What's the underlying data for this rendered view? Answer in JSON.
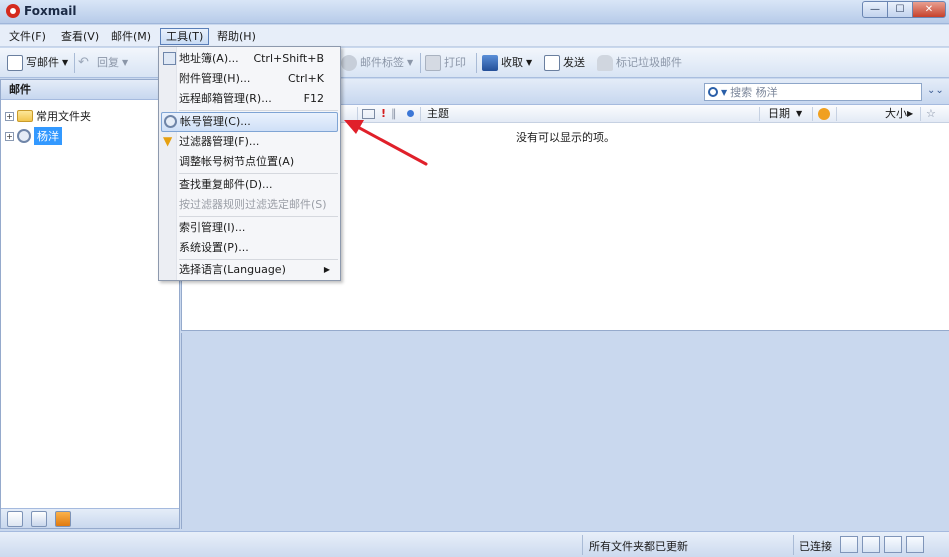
{
  "window": {
    "title": "Foxmail"
  },
  "menubar": {
    "items": [
      "文件(F)",
      "查看(V)",
      "邮件(M)",
      "工具(T)",
      "帮助(H)"
    ]
  },
  "toolbar": {
    "compose": "写邮件",
    "reply": "回复",
    "tag": "邮件标签",
    "print": "打印",
    "receive": "收取",
    "send": "发送",
    "junk": "标记垃圾邮件"
  },
  "folder_pane": {
    "header": "邮件",
    "tree": [
      {
        "label": "常用文件夹",
        "selected": false
      },
      {
        "label": "杨洋",
        "selected": true
      }
    ]
  },
  "search": {
    "placeholder": "搜索 杨洋"
  },
  "list": {
    "columns": {
      "subject": "主题",
      "date": "日期",
      "size": "大小"
    },
    "empty_message": "没有可以显示的项。"
  },
  "statusbar": {
    "message": "所有文件夹都已更新",
    "connection": "已连接"
  },
  "tools_menu": {
    "items": [
      {
        "label": "地址簿(A)...",
        "shortcut": "Ctrl+Shift+B",
        "disabled": false
      },
      {
        "label": "附件管理(H)...",
        "shortcut": "Ctrl+K",
        "disabled": false
      },
      {
        "label": "远程邮箱管理(R)...",
        "shortcut": "F12",
        "disabled": false
      },
      {
        "label": "帐号管理(C)...",
        "shortcut": "",
        "disabled": false,
        "highlight": true
      },
      {
        "label": "过滤器管理(F)...",
        "shortcut": "",
        "disabled": false
      },
      {
        "label": "调整帐号树节点位置(A)",
        "shortcut": "",
        "disabled": false
      },
      {
        "label": "查找重复邮件(D)...",
        "shortcut": "",
        "disabled": false
      },
      {
        "label": "按过滤器规则过滤选定邮件(S)",
        "shortcut": "",
        "disabled": true
      },
      {
        "label": "索引管理(I)...",
        "shortcut": "",
        "disabled": false
      },
      {
        "label": "系统设置(P)...",
        "shortcut": "",
        "disabled": false
      },
      {
        "label": "选择语言(Language)",
        "shortcut": "",
        "disabled": false
      }
    ]
  },
  "colors": {
    "accent": "#3399ff",
    "annotation_arrow": "#e0202a",
    "logo": "#d42a1e"
  }
}
